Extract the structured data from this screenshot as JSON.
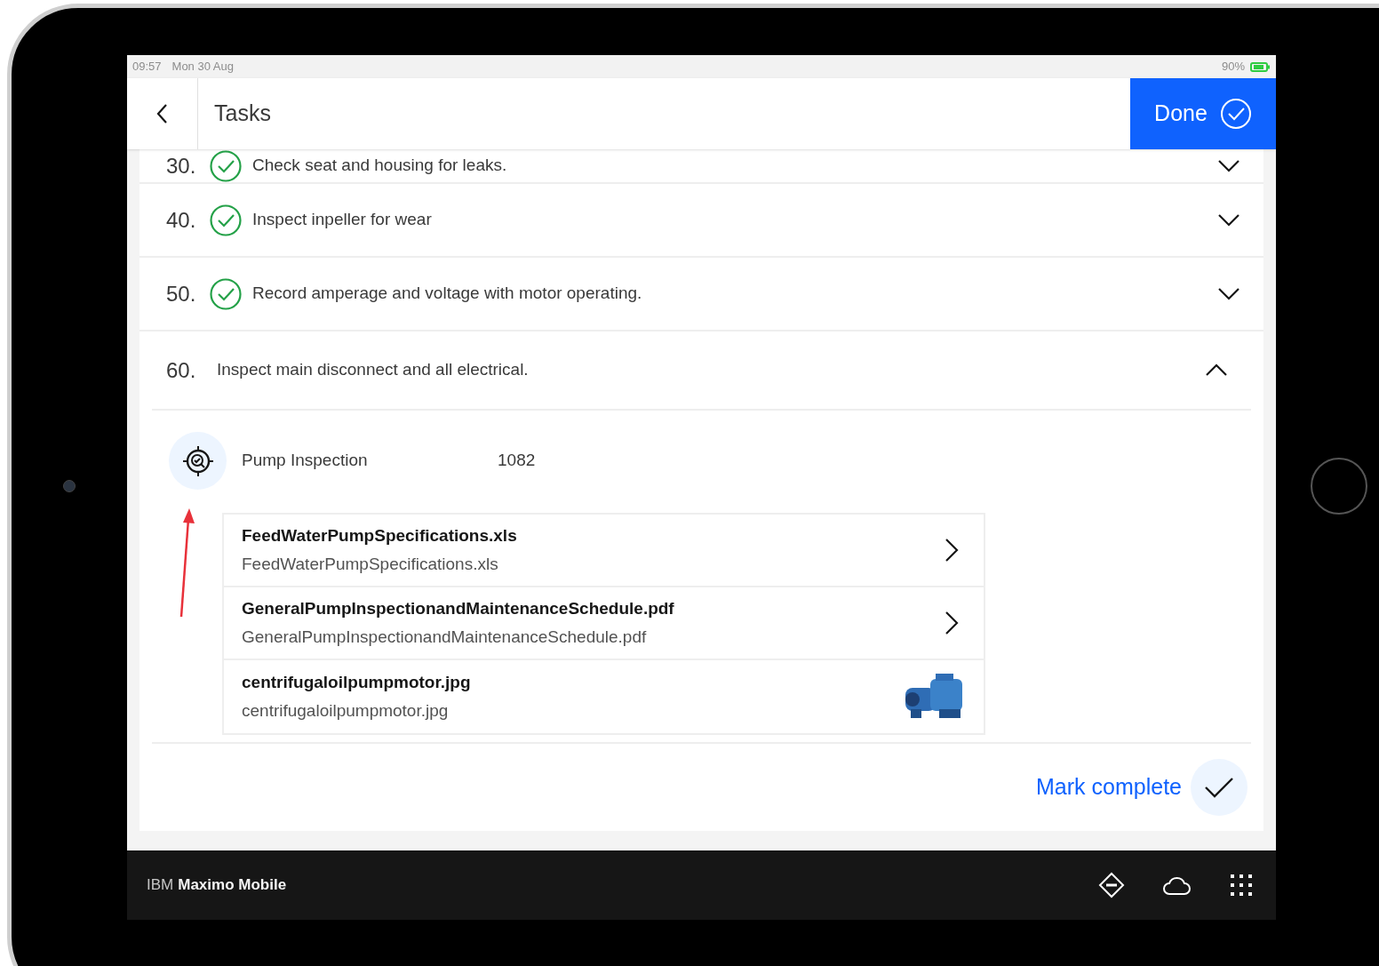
{
  "status_bar": {
    "time": "09:57",
    "date": "Mon 30 Aug",
    "battery": "90%"
  },
  "header": {
    "title": "Tasks",
    "done_button": "Done"
  },
  "tasks": [
    {
      "number": "30.",
      "title": "Check seat and housing for leaks.",
      "complete": true,
      "expanded": false
    },
    {
      "number": "40.",
      "title": "Inspect inpeller for wear",
      "complete": true,
      "expanded": false
    },
    {
      "number": "50.",
      "title": "Record amperage and voltage with motor operating.",
      "complete": true,
      "expanded": false
    },
    {
      "number": "60.",
      "title": "Inspect main disconnect and all electrical.",
      "complete": false,
      "expanded": true
    }
  ],
  "expanded_task": {
    "asset_name": "Pump Inspection",
    "asset_number": "1082",
    "attachments": [
      {
        "kind": "document",
        "title": "FeedWaterPumpSpecifications.xls",
        "filename": "FeedWaterPumpSpecifications.xls"
      },
      {
        "kind": "document",
        "title": "GeneralPumpInspectionandMaintenanceSchedule.pdf",
        "filename": "GeneralPumpInspectionandMaintenanceSchedule.pdf"
      },
      {
        "kind": "image",
        "title": "centrifugaloilpumpmotor.jpg",
        "filename": "centrifugaloilpumpmotor.jpg"
      }
    ],
    "mark_complete": "Mark complete"
  },
  "footer": {
    "brand_light": "IBM",
    "brand_bold": "Maximo Mobile"
  }
}
